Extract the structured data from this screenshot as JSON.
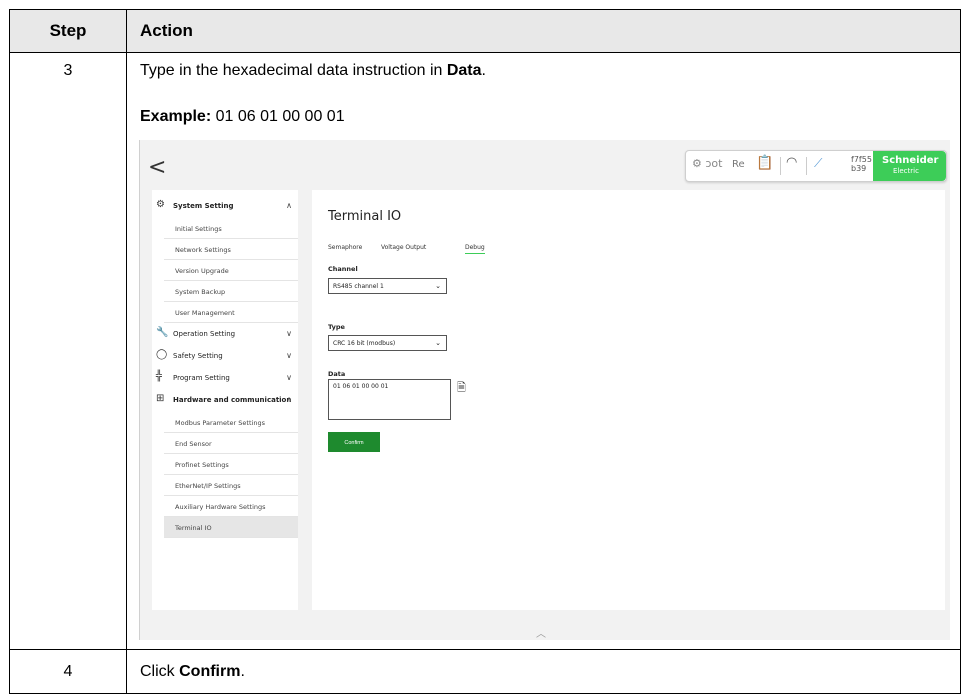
{
  "table": {
    "header_step": "Step",
    "header_action": "Action",
    "row1": {
      "step": "3",
      "line1_prefix": "Type in the hexadecimal data instruction in ",
      "line1_bold": "Data",
      "line1_suffix": ".",
      "example_label": "Example:",
      "example_value": " 01 06 01 00 00 01"
    },
    "row2": {
      "step": "4",
      "prefix": "Click ",
      "bold": "Confirm",
      "suffix": "."
    }
  },
  "app": {
    "back_glyph": "<",
    "status": {
      "robot_text": "ɔot",
      "re_text": "Re",
      "id_line1": "f7f55",
      "id_line2": "b39",
      "logo_line1": "Schneider",
      "logo_line2": "Electric",
      "brand_color": "#3dcd58"
    },
    "sidebar": {
      "system_setting": "System Setting",
      "system_items": [
        "Initial Settings",
        "Network Settings",
        "Version Upgrade",
        "System Backup",
        "User Management"
      ],
      "operation_setting": "Operation Setting",
      "safety_setting": "Safety Setting",
      "program_setting": "Program Setting",
      "hardware_comm": "Hardware and communication",
      "hardware_items": [
        "Modbus Parameter Settings",
        "End Sensor",
        "Profinet Settings",
        "EtherNet/IP Settings",
        "Auxiliary Hardware Settings",
        "Terminal IO"
      ]
    },
    "main": {
      "title": "Terminal IO",
      "tabs": [
        "Semaphore",
        "Voltage Output",
        "Debug"
      ],
      "active_tab": "Debug",
      "channel_label": "Channel",
      "channel_value": "RS485 channel 1",
      "type_label": "Type",
      "type_value": "CRC 16 bit (modbus)",
      "data_label": "Data",
      "data_value": "01 06 01 00 00 01",
      "confirm_label": "Confirm",
      "confirm_color": "#1e8a2e"
    }
  }
}
